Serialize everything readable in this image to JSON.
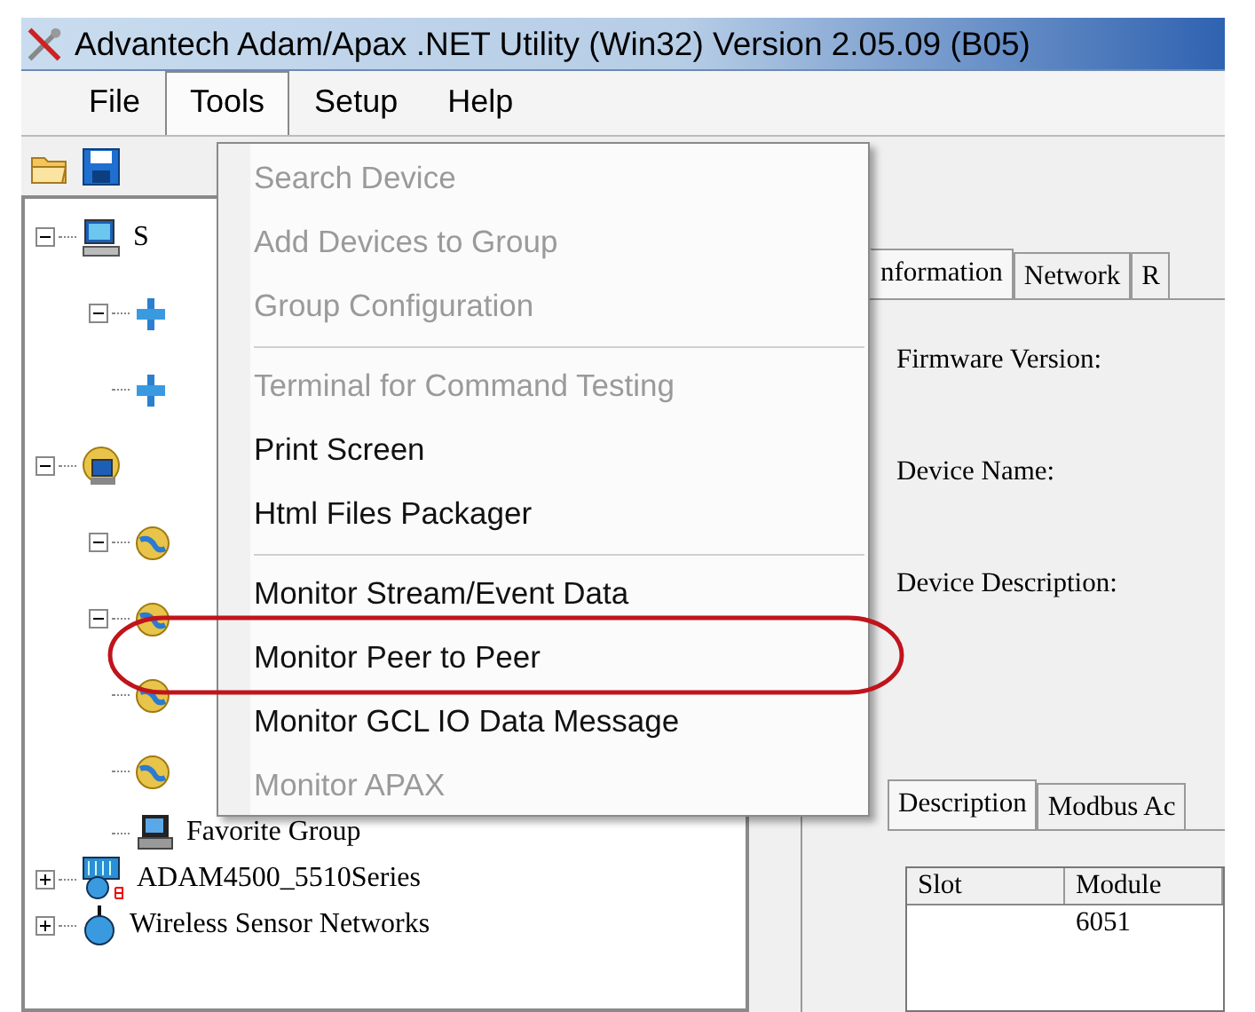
{
  "window": {
    "title": "Advantech Adam/Apax .NET Utility (Win32) Version 2.05.09 (B05)"
  },
  "menu_bar": [
    {
      "label": "File",
      "selected": false
    },
    {
      "label": "Tools",
      "selected": true
    },
    {
      "label": "Setup",
      "selected": false
    },
    {
      "label": "Help",
      "selected": false
    }
  ],
  "tools_menu": [
    {
      "kind": "item",
      "label": "Search Device",
      "disabled": true
    },
    {
      "kind": "item",
      "label": "Add Devices to Group",
      "disabled": true
    },
    {
      "kind": "item",
      "label": "Group Configuration",
      "disabled": true
    },
    {
      "kind": "separator"
    },
    {
      "kind": "item",
      "label": "Terminal for Command Testing",
      "disabled": true
    },
    {
      "kind": "item",
      "label": "Print Screen",
      "disabled": false
    },
    {
      "kind": "item",
      "label": "Html Files Packager",
      "disabled": false
    },
    {
      "kind": "separator"
    },
    {
      "kind": "item",
      "label": "Monitor Stream/Event Data",
      "disabled": false
    },
    {
      "kind": "item",
      "label": "Monitor Peer to Peer",
      "disabled": false
    },
    {
      "kind": "item",
      "label": "Monitor GCL IO Data Message",
      "disabled": false
    },
    {
      "kind": "item",
      "label": "Monitor APAX",
      "disabled": true
    }
  ],
  "annotation": {
    "kind": "ellipse"
  },
  "tree": [
    {
      "kind": "computer",
      "label": "S",
      "expanded": true,
      "children": [
        {
          "kind": "network",
          "expanded": true
        },
        {
          "kind": "network"
        }
      ]
    },
    {
      "kind": "globe-computer",
      "expanded": true,
      "children": [
        {
          "kind": "globe",
          "expanded": true
        },
        {
          "kind": "globe",
          "expanded": true
        },
        {
          "kind": "globe"
        },
        {
          "kind": "globe"
        },
        {
          "kind": "favorite",
          "label": "Favorite Group"
        }
      ]
    },
    {
      "kind": "module",
      "label": "ADAM4500_5510Series",
      "expanded": false
    },
    {
      "kind": "sensor",
      "label": "Wireless Sensor Networks",
      "expanded": false
    }
  ],
  "info_tabs": [
    {
      "label": "nformation",
      "selected": true
    },
    {
      "label": "Network",
      "selected": false
    },
    {
      "label": "R",
      "selected": false
    }
  ],
  "info_fields": [
    "Firmware Version:",
    "Device Name:",
    "Device Description:"
  ],
  "module_tabs": [
    {
      "label": "Description",
      "selected": true
    },
    {
      "label": "Modbus Ac",
      "selected": false
    }
  ],
  "module_table": {
    "columns": [
      "Slot",
      "Module"
    ],
    "rows": [
      [
        "",
        "6051"
      ]
    ]
  }
}
